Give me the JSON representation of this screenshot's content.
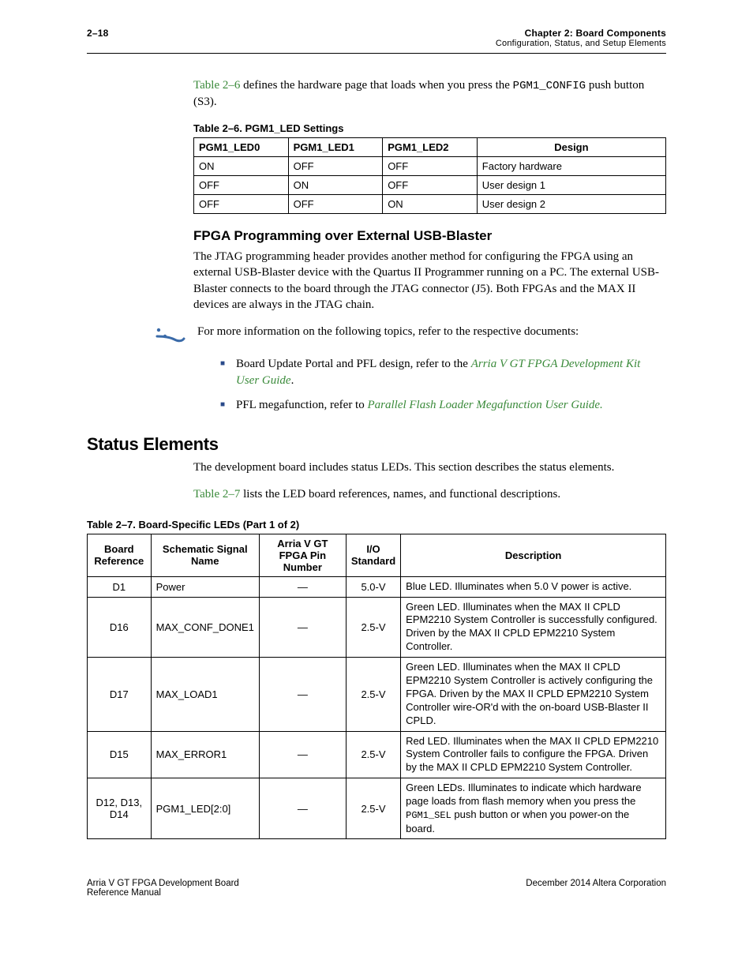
{
  "header": {
    "page": "2–18",
    "chapter": "Chapter 2:  Board Components",
    "section": "Configuration, Status, and Setup Elements"
  },
  "intro": {
    "ref": "Table 2–6",
    "rest1": " defines the hardware page that loads when you press the ",
    "code": "PGM1_CONFIG",
    "rest2": " push button (S3)."
  },
  "table26": {
    "caption": "Table 2–6.  PGM1_LED Settings",
    "headers": [
      "PGM1_LED0",
      "PGM1_LED1",
      "PGM1_LED2",
      "Design"
    ],
    "rows": [
      [
        "ON",
        "OFF",
        "OFF",
        "Factory hardware"
      ],
      [
        "OFF",
        "ON",
        "OFF",
        "User design 1"
      ],
      [
        "OFF",
        "OFF",
        "ON",
        "User design 2"
      ]
    ]
  },
  "fpga_heading": "FPGA Programming over External USB-Blaster",
  "fpga_para": "The JTAG programming header provides another method for configuring the FPGA using an external USB-Blaster device with the Quartus II Programmer running on a PC. The external USB-Blaster connects to the board through the JTAG connector (J5). Both FPGAs and the MAX II devices are always in the JTAG chain.",
  "info_text": "For more information on the following topics, refer to the respective documents:",
  "bullets": [
    {
      "pre": "Board Update Portal and PFL design, refer to the ",
      "link": "Arria V GT FPGA Development Kit User Guide",
      "post": "."
    },
    {
      "pre": "PFL megafunction, refer to ",
      "link": "Parallel Flash Loader Megafunction User Guide.",
      "post": ""
    }
  ],
  "status_heading": "Status Elements",
  "status_para1": "The development board includes status LEDs. This section describes the status elements.",
  "status_para2": {
    "ref": "Table 2–7",
    "rest": " lists the LED board references, names, and functional descriptions."
  },
  "table27": {
    "caption": "Table 2–7.  Board-Specific LEDs  (Part 1 of 2)",
    "headers": [
      "Board Reference",
      "Schematic Signal Name",
      "Arria V GT FPGA Pin Number",
      "I/O Standard",
      "Description"
    ],
    "rows": [
      {
        "ref": "D1",
        "sig": "Power",
        "pin": "—",
        "io": "5.0-V",
        "desc": "Blue LED. Illuminates when 5.0 V power is active."
      },
      {
        "ref": "D16",
        "sig": "MAX_CONF_DONE1",
        "pin": "—",
        "io": "2.5-V",
        "desc": "Green LED. Illuminates when the MAX II CPLD EPM2210 System Controller is successfully configured. Driven by the MAX II CPLD EPM2210 System Controller."
      },
      {
        "ref": "D17",
        "sig": "MAX_LOAD1",
        "pin": "—",
        "io": "2.5-V",
        "desc": "Green LED. Illuminates when the MAX II CPLD EPM2210 System Controller is actively configuring the FPGA. Driven by the MAX II CPLD EPM2210 System Controller wire-OR'd with the on-board USB-Blaster II CPLD."
      },
      {
        "ref": "D15",
        "sig": "MAX_ERROR1",
        "pin": "—",
        "io": "2.5-V",
        "desc": "Red LED. Illuminates when the MAX II CPLD EPM2210 System Controller fails to configure the FPGA. Driven by the MAX II CPLD EPM2210 System Controller."
      },
      {
        "ref": "D12, D13, D14",
        "sig": "PGM1_LED[2:0]",
        "pin": "—",
        "io": "2.5-V",
        "desc_pre": "Green LEDs. Illuminates to indicate which hardware page loads from flash memory when you press the ",
        "desc_code": "PGM1_SEL",
        "desc_post": " push button or when you power-on the board."
      }
    ]
  },
  "footer": {
    "left1": "Arria V GT FPGA Development Board",
    "left2": "Reference Manual",
    "right": "December 2014   Altera Corporation"
  }
}
